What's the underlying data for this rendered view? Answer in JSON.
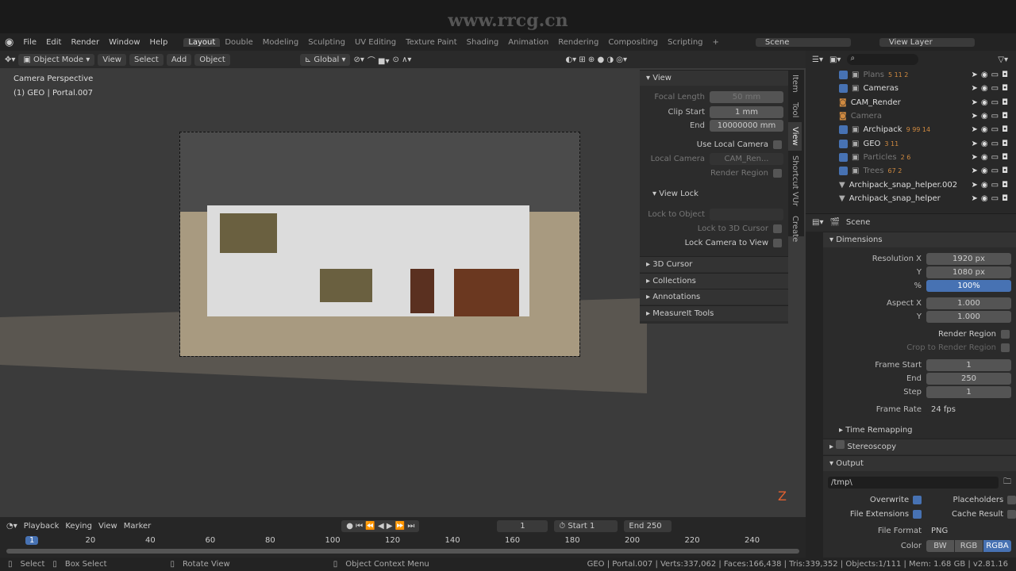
{
  "watermark": "www.rrcg.cn",
  "menu": [
    "File",
    "Edit",
    "Render",
    "Window",
    "Help"
  ],
  "workspaces": [
    "Layout",
    "Double",
    "Modeling",
    "Sculpting",
    "UV Editing",
    "Texture Paint",
    "Shading",
    "Animation",
    "Rendering",
    "Compositing",
    "Scripting",
    "+"
  ],
  "scene": "Scene",
  "view_layer": "View Layer",
  "header": {
    "mode": "Object Mode",
    "menus": [
      "View",
      "Select",
      "Add",
      "Object"
    ],
    "orientation": "Global"
  },
  "viewport": {
    "line1": "Camera Perspective",
    "line2": "(1) GEO | Portal.007",
    "axis": "Z"
  },
  "npanel": {
    "tabs": [
      "Item",
      "Tool",
      "View",
      "Shortcut VUr",
      "Create"
    ],
    "view": "View",
    "focal_label": "Focal Length",
    "focal": "50 mm",
    "clip_start_label": "Clip Start",
    "clip_start": "1 mm",
    "end_label": "End",
    "end": "10000000 mm",
    "use_local_camera": "Use Local Camera",
    "local_camera_label": "Local Camera",
    "local_camera": "CAM_Ren...",
    "render_region": "Render Region",
    "view_lock": "View Lock",
    "lock_object": "Lock to Object",
    "lock_cursor": "Lock to 3D Cursor",
    "lock_camera": "Lock Camera to View",
    "sections": [
      "3D Cursor",
      "Collections",
      "Annotations",
      "MeasureIt Tools"
    ]
  },
  "outliner": [
    {
      "name": "Plans",
      "badges": "5 11 2"
    },
    {
      "name": "Cameras",
      "badges": ""
    },
    {
      "name": "CAM_Render",
      "badges": ""
    },
    {
      "name": "Camera",
      "badges": ""
    },
    {
      "name": "Archipack",
      "badges": "9 99 14"
    },
    {
      "name": "GEO",
      "badges": "3 11"
    },
    {
      "name": "Particles",
      "badges": "2 6"
    },
    {
      "name": "Trees",
      "badges": "67 2"
    },
    {
      "name": "Archipack_snap_helper.002",
      "badges": ""
    },
    {
      "name": "Archipack_snap_helper",
      "badges": ""
    }
  ],
  "properties": {
    "context": "Scene",
    "dimensions": "Dimensions",
    "res_x_label": "Resolution X",
    "res_x": "1920 px",
    "y_label": "Y",
    "res_y": "1080 px",
    "pct_label": "%",
    "pct": "100%",
    "aspect_x_label": "Aspect X",
    "aspect_x": "1.000",
    "aspect_y": "1.000",
    "render_region": "Render Region",
    "crop": "Crop to Render Region",
    "frame_start_label": "Frame Start",
    "frame_start": "1",
    "end_label": "End",
    "frame_end": "250",
    "step_label": "Step",
    "step": "1",
    "frame_rate_label": "Frame Rate",
    "frame_rate": "24 fps",
    "time_remapping": "Time Remapping",
    "stereoscopy": "Stereoscopy",
    "output": "Output",
    "path": "/tmp\\",
    "overwrite": "Overwrite",
    "placeholders": "Placeholders",
    "file_ext": "File Extensions",
    "cache": "Cache Result",
    "file_format_label": "File Format",
    "file_format": "PNG",
    "color_label": "Color",
    "color_opts": [
      "BW",
      "RGB",
      "RGBA"
    ],
    "color_selected": "RGBA"
  },
  "timeline": {
    "menus": [
      "Playback",
      "Keying",
      "View",
      "Marker"
    ],
    "current": "1",
    "start_label": "Start",
    "start": "1",
    "end_label": "End",
    "end": "250",
    "ticks": [
      "1",
      "20",
      "40",
      "60",
      "80",
      "100",
      "120",
      "140",
      "160",
      "180",
      "200",
      "220",
      "240"
    ]
  },
  "status": {
    "select": "Select",
    "box": "Box Select",
    "rotate": "Rotate View",
    "context": "Object Context Menu",
    "stats": "GEO | Portal.007 | Verts:337,062 | Faces:166,438 | Tris:339,352 | Objects:1/111 | Mem: 1.68 GB | v2.81.16"
  },
  "colors": {
    "accent": "#4772b3",
    "bg": "#1d1d1d"
  }
}
